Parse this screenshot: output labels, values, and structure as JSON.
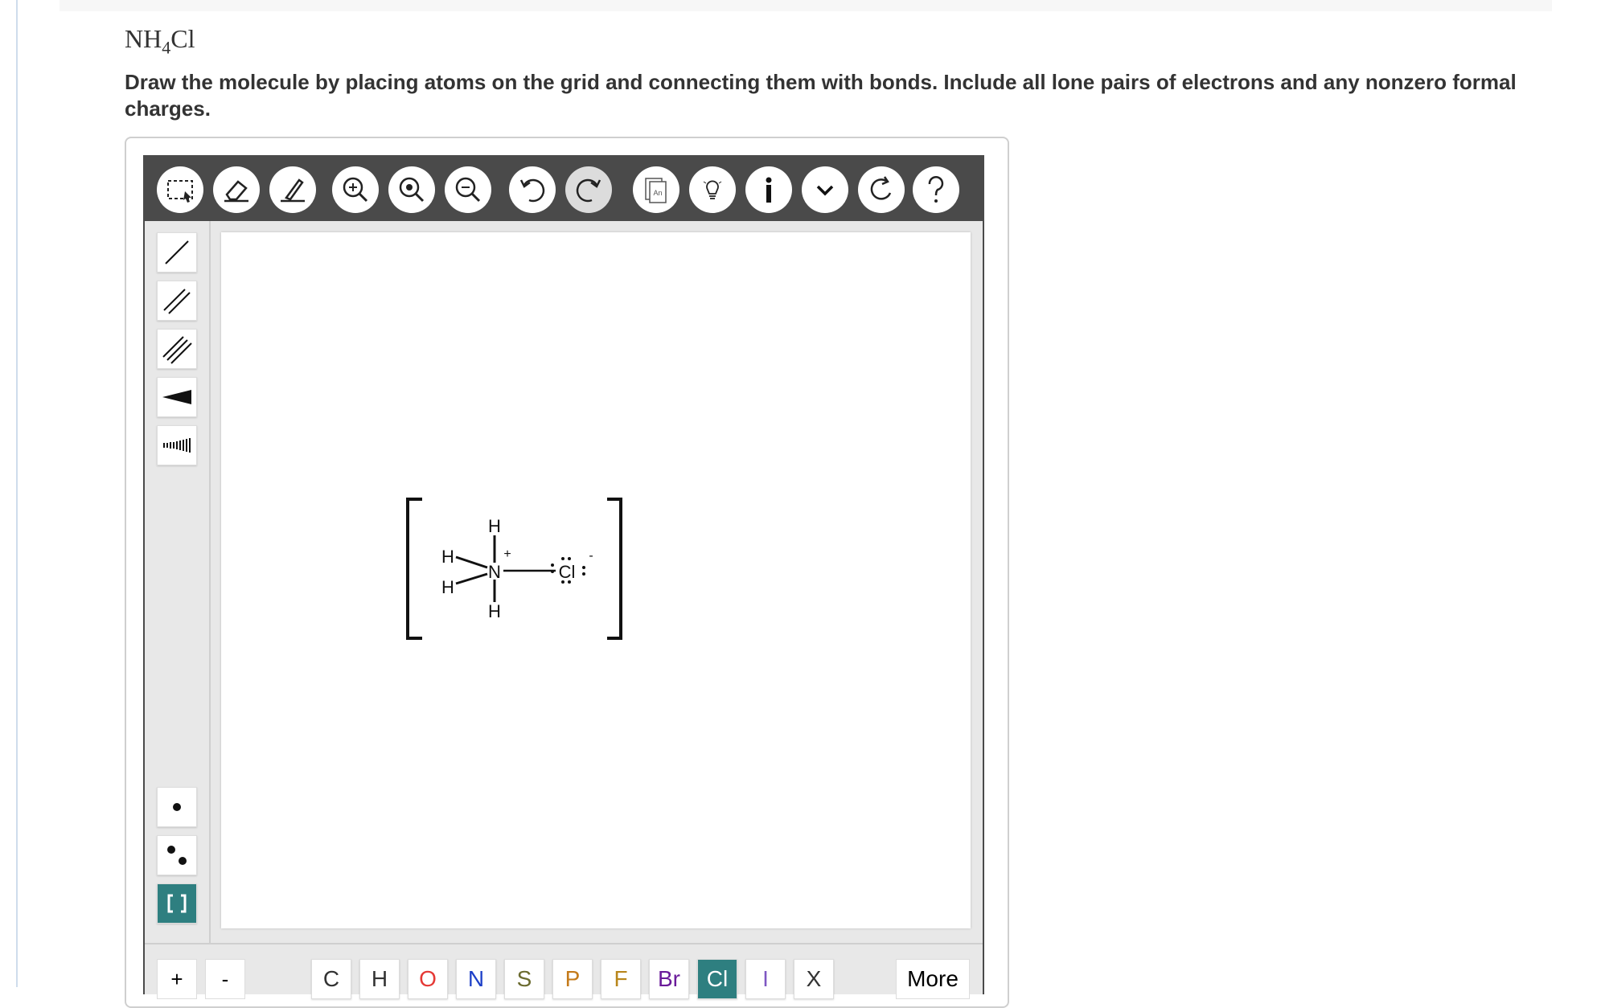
{
  "question": {
    "formula_base": "NH",
    "formula_sub": "4",
    "formula_tail": "Cl",
    "instructions": "Draw the molecule by placing atoms on the grid and connecting them with bonds. Include all lone pairs of electrons and any nonzero formal charges."
  },
  "toolbar": {
    "buttons": [
      {
        "name": "select-icon"
      },
      {
        "name": "eraser-icon"
      },
      {
        "name": "draw-icon"
      },
      {
        "name": "zoom-in-icon"
      },
      {
        "name": "zoom-reset-icon"
      },
      {
        "name": "zoom-out-icon"
      },
      {
        "name": "undo-icon"
      },
      {
        "name": "redo-icon"
      },
      {
        "name": "copy-label-icon",
        "label": "An"
      },
      {
        "name": "hint-bulb-icon"
      },
      {
        "name": "info-icon"
      },
      {
        "name": "chevron-down-icon"
      },
      {
        "name": "reset-icon"
      },
      {
        "name": "help-icon"
      }
    ]
  },
  "sidebar": {
    "tools": [
      {
        "name": "single-bond-icon"
      },
      {
        "name": "double-bond-icon"
      },
      {
        "name": "triple-bond-icon"
      },
      {
        "name": "wedge-bond-icon"
      },
      {
        "name": "hash-bond-icon"
      },
      {
        "name": "single-electron-icon"
      },
      {
        "name": "lone-pair-icon"
      },
      {
        "name": "bracket-icon",
        "active": true
      }
    ]
  },
  "molecule": {
    "atoms": {
      "n": "N",
      "h_top": "H",
      "h_bottom": "H",
      "h_upper_left": "H",
      "h_lower_left": "H",
      "cl": "Cl"
    },
    "n_charge": "+",
    "cl_charge": "-"
  },
  "bottom": {
    "charges": [
      "+",
      "-"
    ],
    "elements": [
      {
        "symbol": "C",
        "color": "#333333"
      },
      {
        "symbol": "H",
        "color": "#333333"
      },
      {
        "symbol": "O",
        "color": "#e53935"
      },
      {
        "symbol": "N",
        "color": "#1e40c8"
      },
      {
        "symbol": "S",
        "color": "#6b6b2f"
      },
      {
        "symbol": "P",
        "color": "#c47a1a"
      },
      {
        "symbol": "F",
        "color": "#b8861b"
      },
      {
        "symbol": "Br",
        "color": "#6a1b9a"
      },
      {
        "symbol": "Cl",
        "color": "#ffffff",
        "active": true
      },
      {
        "symbol": "I",
        "color": "#7e57c2"
      },
      {
        "symbol": "X",
        "color": "#333333"
      }
    ],
    "more_label": "More"
  }
}
